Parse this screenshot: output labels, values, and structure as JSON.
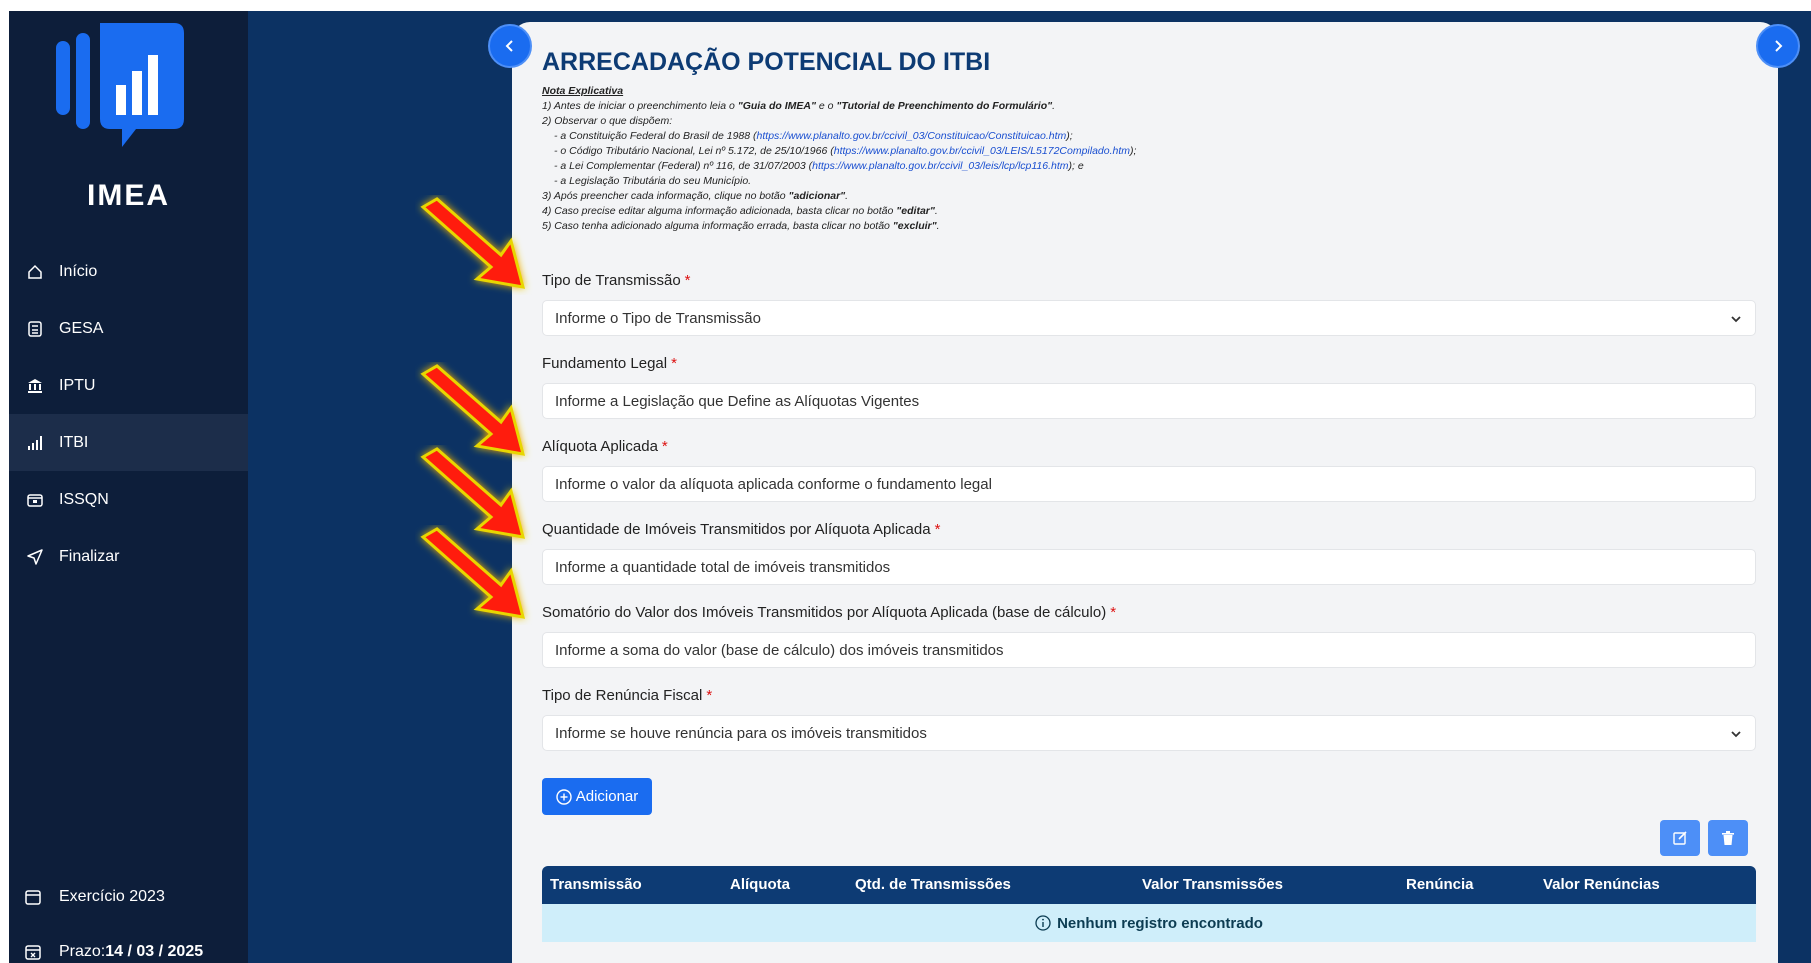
{
  "sidebar": {
    "brand": "IMEA",
    "items": [
      {
        "label": "Início",
        "icon": "home-icon"
      },
      {
        "label": "GESA",
        "icon": "calculator-icon"
      },
      {
        "label": "IPTU",
        "icon": "bank-icon"
      },
      {
        "label": "ITBI",
        "icon": "bar-chart-icon"
      },
      {
        "label": "ISSQN",
        "icon": "wallet-icon"
      },
      {
        "label": "Finalizar",
        "icon": "send-icon"
      }
    ],
    "active": "ITBI",
    "exercise": "Exercício 2023",
    "deadline_label": "Prazo: ",
    "deadline_value": "14 / 03 / 2025"
  },
  "page": {
    "title": "ARRECADAÇÃO POTENCIAL DO ITBI",
    "notes": {
      "heading": "Nota Explicativa",
      "l1_a": "1) Antes de iniciar o preenchimento leia o ",
      "l1_b": "\"Guia do IMEA\"",
      "l1_c": " e o ",
      "l1_d": "\"Tutorial de Preenchimento do Formulário\"",
      "l1_e": ".",
      "l2": "2) Observar o que dispõem:",
      "l3_a": "- a Constituição Federal do Brasil de 1988 (",
      "l3_link": "https://www.planalto.gov.br/ccivil_03/Constituicao/Constituicao.htm",
      "l3_b": ");",
      "l4_a": "- o Código Tributário Nacional, Lei nº 5.172, de 25/10/1966 (",
      "l4_link": "https://www.planalto.gov.br/ccivil_03/LEIS/L5172Compilado.htm",
      "l4_b": ");",
      "l5_a": "- a Lei Complementar (Federal) nº 116, de 31/07/2003 (",
      "l5_link": "https://www.planalto.gov.br/ccivil_03/leis/lcp/lcp116.htm",
      "l5_b": "); e",
      "l6": "- a Legislação Tributária do seu Município.",
      "l7_a": "3) Após preencher cada informação, clique no botão ",
      "l7_b": "\"adicionar\"",
      "l7_c": ".",
      "l8_a": "4) Caso precise editar alguma informação adicionada, basta clicar no botão ",
      "l8_b": "\"editar\"",
      "l8_c": ".",
      "l9_a": "5) Caso tenha adicionado alguma informação errada, basta clicar no botão ",
      "l9_b": "\"excluir\"",
      "l9_c": "."
    }
  },
  "form": {
    "required_mark": "*",
    "transmission_type": {
      "label": "Tipo de Transmissão",
      "placeholder": "Informe o Tipo de Transmissão"
    },
    "legal_basis": {
      "label": "Fundamento Legal",
      "placeholder": "Informe a Legislação que Define as Alíquotas Vigentes"
    },
    "rate": {
      "label": "Alíquota Aplicada",
      "placeholder": "Informe o valor da alíquota aplicada conforme o fundamento legal"
    },
    "quantity": {
      "label": "Quantidade de Imóveis Transmitidos por Alíquota Aplicada",
      "placeholder": "Informe a quantidade total de imóveis transmitidos"
    },
    "sum_value": {
      "label": "Somatório do Valor dos Imóveis Transmitidos por Alíquota Aplicada (base de cálculo)",
      "placeholder": "Informe a soma do valor (base de cálculo) dos imóveis transmitidos"
    },
    "waiver_type": {
      "label": "Tipo de Renúncia Fiscal",
      "placeholder": "Informe se houve renúncia para os imóveis transmitidos"
    },
    "add_label": "Adicionar"
  },
  "table": {
    "columns": [
      "Transmissão",
      "Alíquota",
      "Qtd. de Transmissões",
      "Valor Transmissões",
      "Renúncia",
      "Valor Renúncias"
    ],
    "empty": "Nenhum registro encontrado"
  },
  "colors": {
    "sidebar": "#0d1e3a",
    "band": "#0c3263",
    "primary": "#1a6cf0",
    "title": "#0d3b74",
    "arrow": "#ff1a0a"
  }
}
